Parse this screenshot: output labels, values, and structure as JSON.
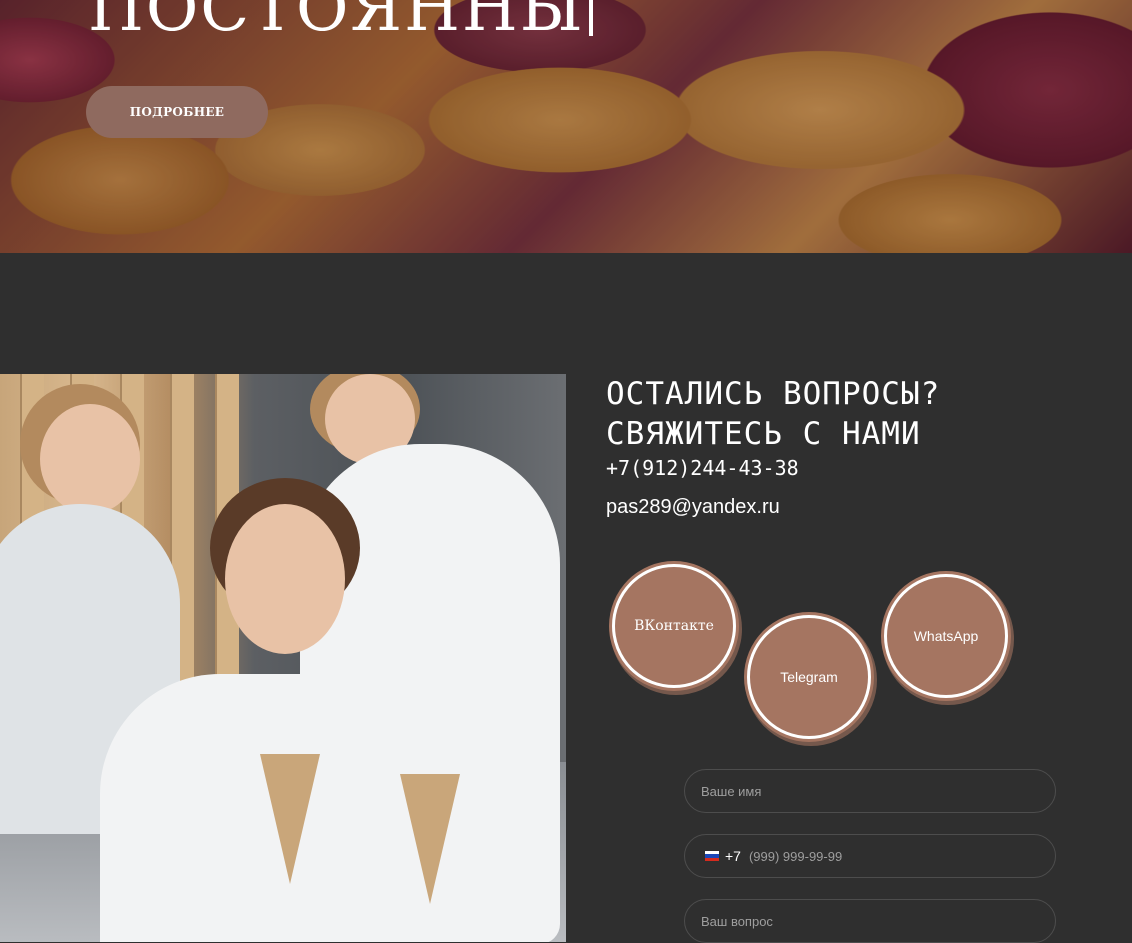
{
  "hero": {
    "title": "ПОСТОЯННЫ",
    "button_label": "ПОДРОБНЕЕ"
  },
  "contact": {
    "title_line1": "ОСТАЛИСЬ ВОПРОСЫ?",
    "title_line2": "СВЯЖИТЕСЬ С НАМИ",
    "phone": "+7(912)244-43-38",
    "email": "pas289@yandex.ru"
  },
  "social": {
    "vk": "ВКонтакте",
    "telegram": "Telegram",
    "whatsapp": "WhatsApp"
  },
  "form": {
    "name_placeholder": "Ваше имя",
    "phone_code": "+7",
    "phone_placeholder": "(999) 999-99-99",
    "question_placeholder": "Ваш вопрос"
  },
  "colors": {
    "background": "#2f2f2f",
    "accent": "#a57561",
    "hero_button": "#8f6a5f"
  }
}
